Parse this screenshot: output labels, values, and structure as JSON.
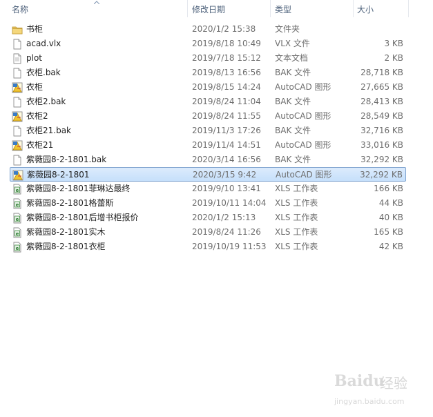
{
  "columns": {
    "name": "名称",
    "date": "修改日期",
    "type": "类型",
    "size": "大小"
  },
  "files": [
    {
      "name": "书柜",
      "date": "2020/1/2 15:38",
      "type": "文件夹",
      "size": "",
      "icon": "folder-icon"
    },
    {
      "name": "acad.vlx",
      "date": "2019/8/18 10:49",
      "type": "VLX 文件",
      "size": "3 KB",
      "icon": "file-icon"
    },
    {
      "name": "plot",
      "date": "2019/7/18 15:12",
      "type": "文本文档",
      "size": "2 KB",
      "icon": "text-file-icon"
    },
    {
      "name": "衣柜.bak",
      "date": "2019/8/13 16:56",
      "type": "BAK 文件",
      "size": "28,718 KB",
      "icon": "file-icon"
    },
    {
      "name": "衣柜",
      "date": "2019/8/15 14:24",
      "type": "AutoCAD 图形",
      "size": "27,665 KB",
      "icon": "autocad-file-icon"
    },
    {
      "name": "衣柜2.bak",
      "date": "2019/8/24 11:04",
      "type": "BAK 文件",
      "size": "28,413 KB",
      "icon": "file-icon"
    },
    {
      "name": "衣柜2",
      "date": "2019/8/24 11:55",
      "type": "AutoCAD 图形",
      "size": "28,549 KB",
      "icon": "autocad-file-icon"
    },
    {
      "name": "衣柜21.bak",
      "date": "2019/11/3 17:26",
      "type": "BAK 文件",
      "size": "32,716 KB",
      "icon": "file-icon"
    },
    {
      "name": "衣柜21",
      "date": "2019/11/4 14:51",
      "type": "AutoCAD 图形",
      "size": "33,016 KB",
      "icon": "autocad-file-icon"
    },
    {
      "name": "紫薇园8-2-1801.bak",
      "date": "2020/3/14 16:56",
      "type": "BAK 文件",
      "size": "32,292 KB",
      "icon": "file-icon"
    },
    {
      "name": "紫薇园8-2-1801",
      "date": "2020/3/15 9:42",
      "type": "AutoCAD 图形",
      "size": "32,292 KB",
      "icon": "autocad-file-icon",
      "selected": true
    },
    {
      "name": "紫薇园8-2-1801菲琳达最终",
      "date": "2019/9/10 13:41",
      "type": "XLS 工作表",
      "size": "166 KB",
      "icon": "spreadsheet-file-icon"
    },
    {
      "name": "紫薇园8-2-1801格蕾斯",
      "date": "2019/10/11 14:04",
      "type": "XLS 工作表",
      "size": "44 KB",
      "icon": "spreadsheet-file-icon"
    },
    {
      "name": "紫薇园8-2-1801后增书柜报价",
      "date": "2020/1/2 15:13",
      "type": "XLS 工作表",
      "size": "40 KB",
      "icon": "spreadsheet-file-icon"
    },
    {
      "name": "紫薇园8-2-1801实木",
      "date": "2019/8/24 11:26",
      "type": "XLS 工作表",
      "size": "165 KB",
      "icon": "spreadsheet-file-icon"
    },
    {
      "name": "紫薇园8-2-1801衣柜",
      "date": "2019/10/19 11:53",
      "type": "XLS 工作表",
      "size": "42 KB",
      "icon": "spreadsheet-file-icon"
    }
  ],
  "watermark": {
    "brand": "Baidu",
    "brand_cn": "经验",
    "url": "jingyan.baidu.com"
  }
}
